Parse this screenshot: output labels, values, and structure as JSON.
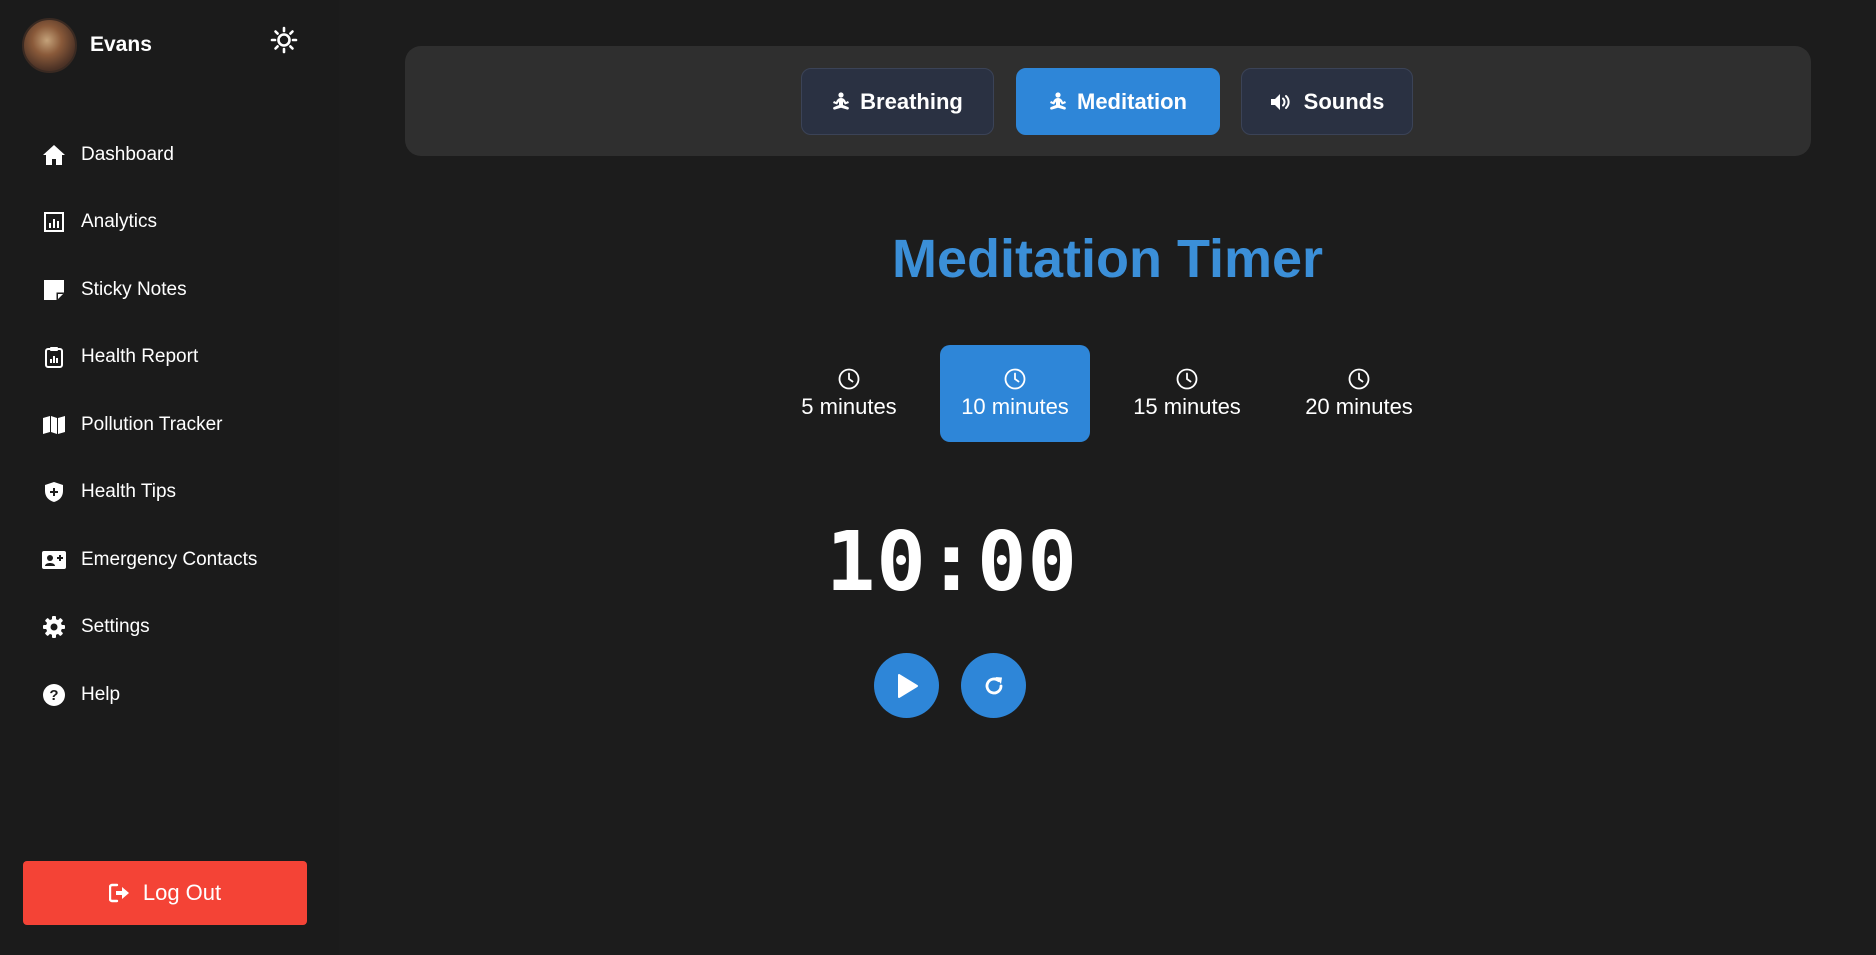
{
  "user": {
    "name": "Evans"
  },
  "sidebar": {
    "items": [
      {
        "label": "Dashboard",
        "icon": "home-icon"
      },
      {
        "label": "Analytics",
        "icon": "analytics-icon"
      },
      {
        "label": "Sticky Notes",
        "icon": "sticky-note-icon"
      },
      {
        "label": "Health Report",
        "icon": "clipboard-icon"
      },
      {
        "label": "Pollution Tracker",
        "icon": "map-icon"
      },
      {
        "label": "Health Tips",
        "icon": "shield-icon"
      },
      {
        "label": "Emergency Contacts",
        "icon": "contact-card-icon"
      },
      {
        "label": "Settings",
        "icon": "gear-icon"
      },
      {
        "label": "Help",
        "icon": "question-icon"
      }
    ],
    "logout_label": "Log Out"
  },
  "tabs": [
    {
      "label": "Breathing",
      "icon": "meditation-icon",
      "active": false
    },
    {
      "label": "Meditation",
      "icon": "meditation-icon",
      "active": true
    },
    {
      "label": "Sounds",
      "icon": "volume-icon",
      "active": false
    }
  ],
  "main": {
    "title": "Meditation Timer",
    "durations": [
      {
        "label": "5 minutes",
        "active": false
      },
      {
        "label": "10 minutes",
        "active": true
      },
      {
        "label": "15 minutes",
        "active": false
      },
      {
        "label": "20 minutes",
        "active": false
      }
    ],
    "timer": "10:00"
  },
  "colors": {
    "accent": "#2e86d8",
    "title": "#3b8fd8",
    "logout": "#f44336",
    "background": "#1c1c1c",
    "panel": "#2f2f2f"
  }
}
